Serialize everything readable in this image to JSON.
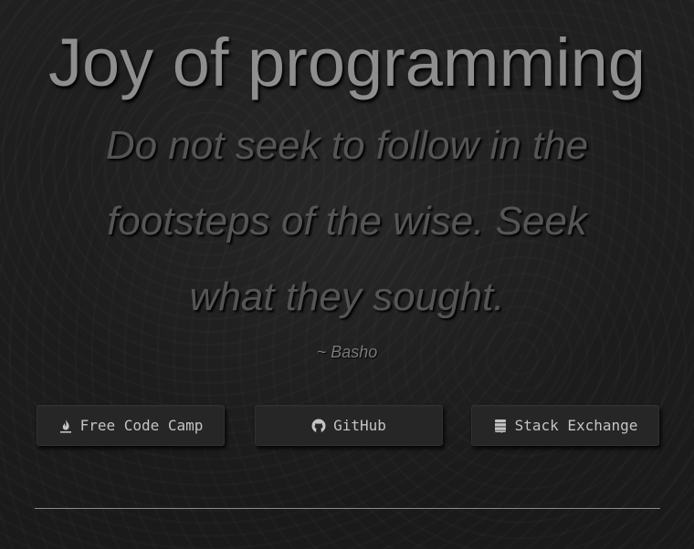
{
  "header": {
    "title": "Joy of programming"
  },
  "quote": {
    "text": "Do not seek to follow in the footsteps of the wise. Seek what they sought.",
    "author": "~ Basho"
  },
  "links": [
    {
      "label": "Free Code Camp",
      "icon": "fire-icon"
    },
    {
      "label": "GitHub",
      "icon": "github-icon"
    },
    {
      "label": "Stack Exchange",
      "icon": "stack-exchange-icon"
    }
  ],
  "colors": {
    "background": "#1c1c1c",
    "title": "#8e8e8e",
    "quote": "#555555",
    "button_bg": "#262626",
    "button_text": "#c4c4c4",
    "divider": "#8a8a8a"
  }
}
